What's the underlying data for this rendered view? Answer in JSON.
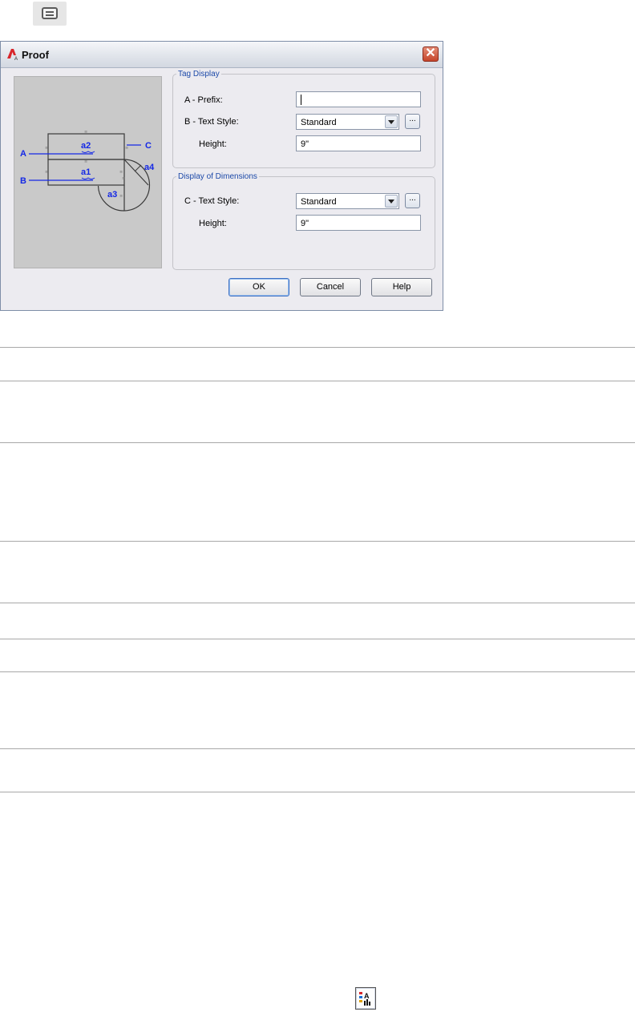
{
  "dialog": {
    "title": "Proof",
    "close_glyph": "✕",
    "preview": {
      "label_a": "A",
      "label_b": "B",
      "label_c": "C",
      "tag_a1": "a1",
      "tag_a2": "a2",
      "tag_a3": "a3",
      "tag_a4": "a4"
    },
    "tag_display": {
      "legend": "Tag Display",
      "prefix_label": "A - Prefix:",
      "prefix_value": "",
      "text_style_label": "B - Text Style:",
      "text_style_value": "Standard",
      "browse_label": "...",
      "height_label": "Height:",
      "height_value": "9\""
    },
    "display_of_dimensions": {
      "legend": "Display of Dimensions",
      "text_style_label": "C - Text Style:",
      "text_style_value": "Standard",
      "browse_label": "...",
      "height_label": "Height:",
      "height_value": "9\""
    },
    "buttons": {
      "ok": "OK",
      "cancel": "Cancel",
      "help": "Help"
    }
  },
  "icons": {
    "top": "dialog-window-icon",
    "title": "autocad-logo-icon",
    "bottom": "proof-tool-icon"
  },
  "colors": {
    "annotation_blue": "#1428e6",
    "group_legend": "#1c49a8",
    "close_red": "#c5452b"
  }
}
